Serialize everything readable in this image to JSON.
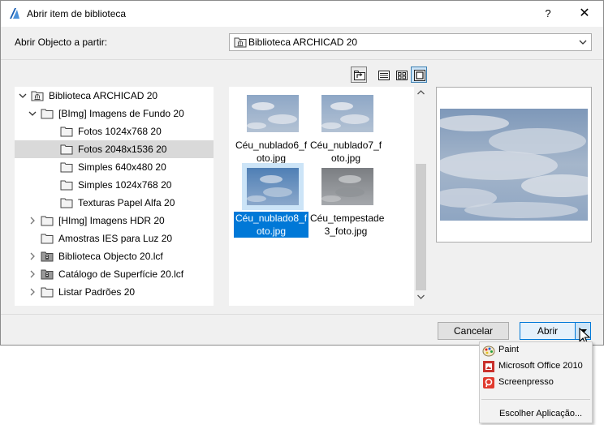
{
  "window": {
    "title": "Abrir item de biblioteca",
    "help_label": "?",
    "close_label": "✕"
  },
  "source": {
    "label": "Abrir Objecto a partir:",
    "selected": "Biblioteca ARCHICAD 20"
  },
  "view_modes": [
    "up-one-level",
    "list",
    "small-thumbnails",
    "large-thumbnails"
  ],
  "active_view_mode": "large-thumbnails",
  "tree": [
    {
      "label": "Biblioteca ARCHICAD 20",
      "level": 0,
      "expander": "expanded",
      "icon": "library-folder-icon"
    },
    {
      "label": "[BImg] Imagens de Fundo 20",
      "level": 1,
      "expander": "expanded",
      "icon": "folder-icon"
    },
    {
      "label": "Fotos 1024x768 20",
      "level": 2,
      "expander": "none",
      "icon": "folder-icon"
    },
    {
      "label": "Fotos 2048x1536 20",
      "level": 2,
      "expander": "none",
      "icon": "folder-icon",
      "selected": true
    },
    {
      "label": "Simples 640x480 20",
      "level": 2,
      "expander": "none",
      "icon": "folder-icon"
    },
    {
      "label": "Simples 1024x768 20",
      "level": 2,
      "expander": "none",
      "icon": "folder-icon"
    },
    {
      "label": "Texturas Papel Alfa 20",
      "level": 2,
      "expander": "none",
      "icon": "folder-icon"
    },
    {
      "label": "[HImg] Imagens HDR 20",
      "level": 1,
      "expander": "collapsed",
      "icon": "folder-icon"
    },
    {
      "label": "Amostras IES para Luz 20",
      "level": 1,
      "expander": "none",
      "icon": "folder-icon"
    },
    {
      "label": "Biblioteca Objecto 20.lcf",
      "level": 1,
      "expander": "collapsed",
      "icon": "lcf-archive-icon"
    },
    {
      "label": "Catálogo de Superfície 20.lcf",
      "level": 1,
      "expander": "collapsed",
      "icon": "lcf-archive-icon"
    },
    {
      "label": "Listar Padrões 20",
      "level": 1,
      "expander": "collapsed",
      "icon": "folder-icon"
    }
  ],
  "thumbnails": [
    {
      "line1": "Céu_nublado6_f",
      "line2": "oto.jpg",
      "sky": "light-clouds"
    },
    {
      "line1": "Céu_nublado7_f",
      "line2": "oto.jpg",
      "sky": "light-clouds"
    },
    {
      "line1": "Céu_nublado8_f",
      "line2": "oto.jpg",
      "sky": "blue-clouds",
      "selected": true
    },
    {
      "line1": "Céu_tempestade",
      "line2": "3_foto.jpg",
      "sky": "storm-grey"
    }
  ],
  "buttons": {
    "cancel": "Cancelar",
    "open": "Abrir"
  },
  "open_with_menu": {
    "items": [
      {
        "label": "Paint",
        "icon": "paint-icon"
      },
      {
        "label": "Microsoft Office 2010",
        "icon": "office-picture-icon"
      },
      {
        "label": "Screenpresso",
        "icon": "screenpresso-icon"
      }
    ],
    "choose_label": "Escolher Aplicação..."
  },
  "colors": {
    "accent": "#0078d7",
    "selection_light": "#cce4f7",
    "tree_selection": "#d9d9d9"
  }
}
